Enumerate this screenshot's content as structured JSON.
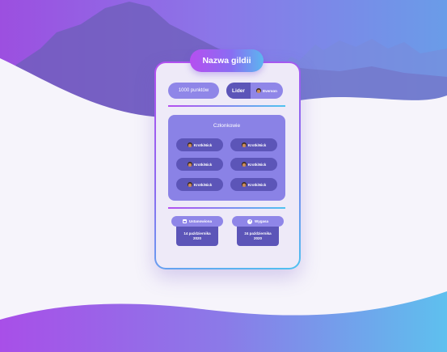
{
  "guild": {
    "title": "Nazwa gildii",
    "points_label": "1000 punktów",
    "leader_label": "Lider",
    "leader_name": "Everson"
  },
  "members": {
    "title": "Członkowie",
    "list": [
      "KrotkiNick",
      "KrotkiNick",
      "KrotkiNick",
      "KrotkiNick",
      "KrotkiNick",
      "KrotkiNick"
    ]
  },
  "dates": {
    "created": {
      "label": "Ustanowiona",
      "date_line1": "14 października",
      "date_line2": "2020"
    },
    "expires": {
      "label": "Wygasa",
      "date_line1": "24 października",
      "date_line2": "2020"
    }
  },
  "colors": {
    "accent_purple": "#b44ff0",
    "accent_blue": "#4fc3f0",
    "panel_dark": "#5c55b8",
    "panel_light": "#8f86e8"
  },
  "icons": {
    "member_avatar": "avatar-icon",
    "created": "calendar-icon",
    "expires": "clock-icon"
  }
}
